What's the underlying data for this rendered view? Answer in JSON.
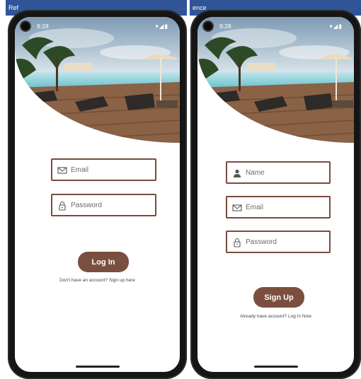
{
  "desktop": {
    "left_fragment": "Ref",
    "right_fragment": "ence"
  },
  "status_bar": {
    "time": "9:28",
    "icons": [
      "settings-icon",
      "sd-card-icon",
      "wifi-icon",
      "signal-icon",
      "battery-icon"
    ]
  },
  "login": {
    "email_placeholder": "Email",
    "password_placeholder": "Password",
    "button_label": "Log In",
    "footer_text": "Don't have an account? Sign up here"
  },
  "signup": {
    "name_placeholder": "Name",
    "email_placeholder": "Email",
    "password_placeholder": "Password",
    "button_label": "Sign Up",
    "footer_text": "Already have account? Log In Now"
  },
  "colors": {
    "accent": "#7b4f3f",
    "field_border": "#7a4a3f",
    "bezel": "#151515"
  }
}
